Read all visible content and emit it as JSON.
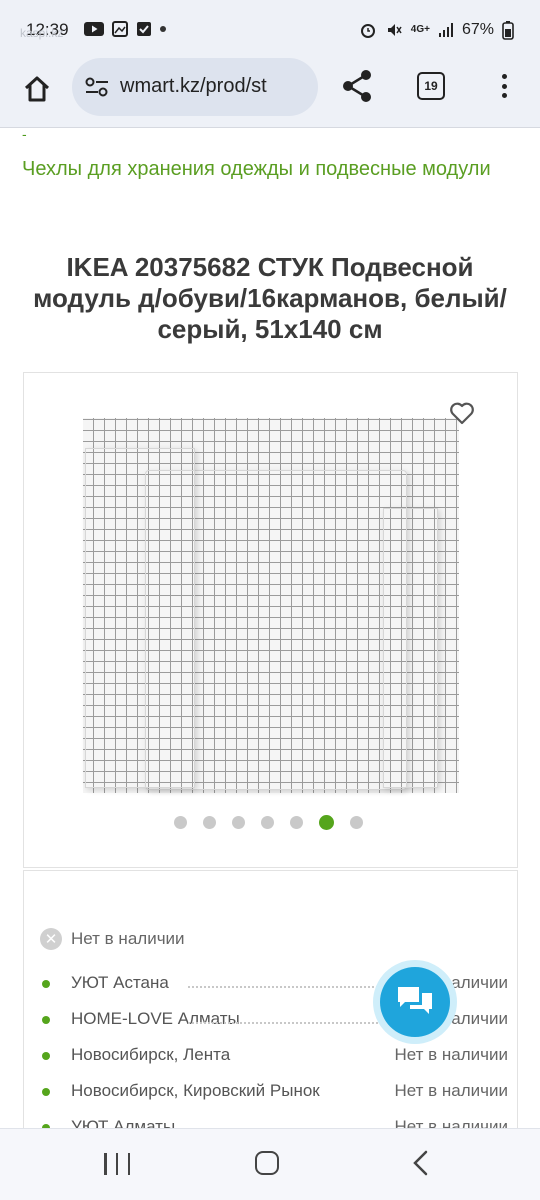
{
  "status_bar": {
    "time": "12:39",
    "overlay_text": "kaspi.kz",
    "network": "4G+",
    "battery": "67%"
  },
  "browser": {
    "url": "wmart.kz/prod/st",
    "tab_count": "19"
  },
  "breadcrumb": {
    "separator": "-",
    "category": "Чехлы для хранения одежды и подвесные модули"
  },
  "product": {
    "title": "IKEA 20375682 СТУК Подвесной модуль д/обуви/16карманов, белый/серый, 51x140 см",
    "gallery": {
      "total_images": 7,
      "active_index": 5
    }
  },
  "availability": {
    "status": "Нет в наличии",
    "stores": [
      {
        "name": "УЮТ Астана",
        "status": "Нет в наличии"
      },
      {
        "name": "HOME-LOVE Алматы",
        "status": "Нет в наличии"
      },
      {
        "name": "Новосибирск, Лента",
        "status": "Нет в наличии"
      },
      {
        "name": "Новосибирск, Кировский Рынок",
        "status": "Нет в наличии"
      },
      {
        "name": "УЮТ Алматы",
        "status": "Нет в наличии"
      }
    ]
  },
  "colors": {
    "accent_green": "#55a51c",
    "chat_blue": "#1fa5dc"
  },
  "icons": {
    "home": "home-icon",
    "site_info": "tune-icon",
    "share": "share-icon",
    "menu": "more-vert-icon",
    "favorite": "heart-icon",
    "chat": "chat-icon",
    "unavailable": "close-circle-icon"
  }
}
